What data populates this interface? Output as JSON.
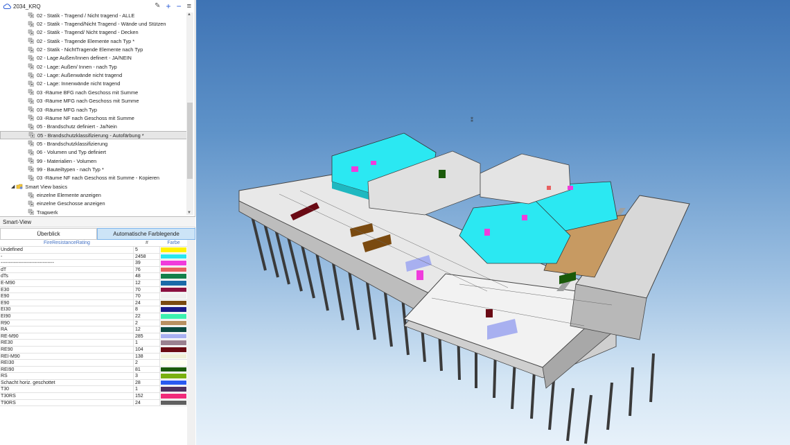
{
  "window": {
    "title": "2034_KRQ"
  },
  "toolbar": {
    "pen_icon": "pencil-icon",
    "add": "+",
    "remove": "−",
    "menu": "≡"
  },
  "tree": {
    "items": [
      {
        "label": "02 - Statik - Tragend / Nicht tragend - ALLE",
        "level": 2,
        "icon": "smartview"
      },
      {
        "label": "02 - Statik - Tragend/Nicht Tragend - Wände und Stützen",
        "level": 2,
        "icon": "smartview"
      },
      {
        "label": "02 - Statik - Tragend/ Nicht tragend - Decken",
        "level": 2,
        "icon": "smartview"
      },
      {
        "label": "02 - Statik - Tragende Elemente nach Typ *",
        "level": 2,
        "icon": "smartview"
      },
      {
        "label": "02 - Statik - NichtTragende Elemente nach Typ",
        "level": 2,
        "icon": "smartview"
      },
      {
        "label": "02 - Lage Außen/Innen definert - JA/NEIN",
        "level": 2,
        "icon": "smartview"
      },
      {
        "label": "02 - Lage: Außen/ Innen - nach Typ",
        "level": 2,
        "icon": "smartview"
      },
      {
        "label": "02 - Lage: Außenwände nicht tragend",
        "level": 2,
        "icon": "smartview"
      },
      {
        "label": "02 - Lage: Innenwände nicht tragend",
        "level": 2,
        "icon": "smartview"
      },
      {
        "label": "03 -Räume BFG nach Geschoss mit Summe",
        "level": 2,
        "icon": "smartview"
      },
      {
        "label": "03 -Räume MFG nach Geschoss mit Summe",
        "level": 2,
        "icon": "smartview"
      },
      {
        "label": "03 -Räume MFG nach Typ",
        "level": 2,
        "icon": "smartview"
      },
      {
        "label": "03 -Räume NF nach Geschoss mit Summe",
        "level": 2,
        "icon": "smartview"
      },
      {
        "label": "05 - Brandschutz definiert -  Ja/Nein",
        "level": 2,
        "icon": "smartview"
      },
      {
        "label": "05 - Brandschutzklassifizierung - Autofärbung *",
        "level": 2,
        "icon": "smartview",
        "selected": true
      },
      {
        "label": "05 - Brandschutzklassifizierung",
        "level": 2,
        "icon": "smartview"
      },
      {
        "label": "06 - Volumen und Typ definiert",
        "level": 2,
        "icon": "smartview"
      },
      {
        "label": "99 - Materialien - Volumen",
        "level": 2,
        "icon": "smartview"
      },
      {
        "label": "99 - Bauteiltypen - nach Typ  *",
        "level": 2,
        "icon": "smartview"
      },
      {
        "label": "03 -Räume NF nach Geschoss mit Summe  - Kopieren",
        "level": 2,
        "icon": "smartview"
      },
      {
        "label": "Smart View basics",
        "level": 1,
        "icon": "folder",
        "expanded": true
      },
      {
        "label": "einzelne Elemente anzeigen",
        "level": 2,
        "icon": "smartview"
      },
      {
        "label": "einzelne Geschosse anzeigen",
        "level": 2,
        "icon": "smartview"
      },
      {
        "label": "Tragwerk",
        "level": 2,
        "icon": "smartview"
      }
    ]
  },
  "smartview": {
    "header": "Smart-View",
    "tabs": [
      "Überblick",
      "Automatische Farblegende"
    ],
    "active_tab": 1,
    "columns": [
      "FireResistanceRating",
      "#",
      "Farbe"
    ],
    "rows": [
      {
        "name": "Undefined",
        "count": "5",
        "color": "#fff200"
      },
      {
        "name": "-",
        "count": "2458",
        "color": "#29e6f0"
      },
      {
        "name": "---------------------------------",
        "count": "39",
        "color": "#f03cdc"
      },
      {
        "name": "dT",
        "count": "76",
        "color": "#e86060"
      },
      {
        "name": "dTs",
        "count": "48",
        "color": "#13804a"
      },
      {
        "name": "E-M90",
        "count": "12",
        "color": "#1a6aa8"
      },
      {
        "name": "E30",
        "count": "70",
        "color": "#8a1040"
      },
      {
        "name": "E90",
        "count": "70",
        "color": "#f0f0f0"
      },
      {
        "name": "E90",
        "count": "24",
        "color": "#7a4a10"
      },
      {
        "name": "EI30",
        "count": "8",
        "color": "#1a1a8a"
      },
      {
        "name": "EI90",
        "count": "22",
        "color": "#3cf0b0"
      },
      {
        "name": "R90",
        "count": "2",
        "color": "#b89060"
      },
      {
        "name": "RA",
        "count": "12",
        "color": "#0a4a40"
      },
      {
        "name": "RE-M90",
        "count": "285",
        "color": "#a8b0f0"
      },
      {
        "name": "RE30",
        "count": "1",
        "color": "#9a8090"
      },
      {
        "name": "RE90",
        "count": "104",
        "color": "#6a0a14"
      },
      {
        "name": "REI-M90",
        "count": "138",
        "color": "#f0f0d8"
      },
      {
        "name": "REI30",
        "count": "2",
        "color": "#fffff0"
      },
      {
        "name": "REI90",
        "count": "81",
        "color": "#1a5a0a"
      },
      {
        "name": "RS",
        "count": "3",
        "color": "#7ab010"
      },
      {
        "name": "Schacht horiz. geschottet",
        "count": "28",
        "color": "#2a5af0"
      },
      {
        "name": "T30",
        "count": "1",
        "color": "#503060"
      },
      {
        "name": "T30RS",
        "count": "152",
        "color": "#f02a7a"
      },
      {
        "name": "T90RS",
        "count": "24",
        "color": "#606060"
      }
    ]
  },
  "viewport": {
    "label": "3d-model-view"
  }
}
